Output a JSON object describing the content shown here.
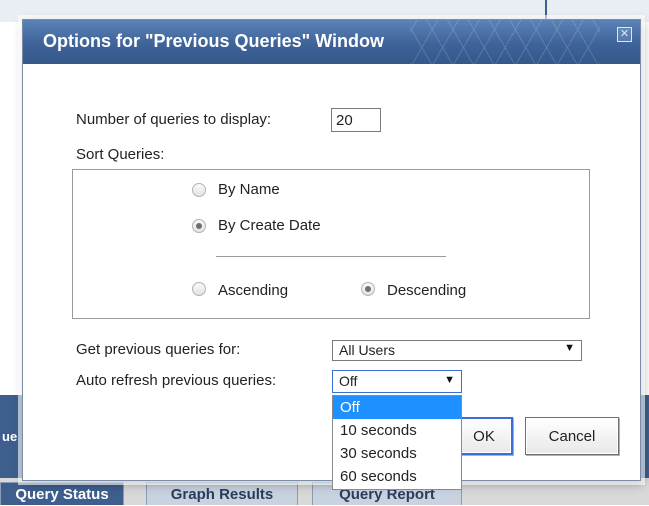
{
  "dialog": {
    "title": "Options for \"Previous Queries\" Window",
    "close_icon": "close-icon",
    "num_queries_label": "Number of queries to display:",
    "num_queries_value": "20",
    "sort_label": "Sort Queries:",
    "sort_by_options": [
      {
        "label": "By Name",
        "checked": false
      },
      {
        "label": "By Create Date",
        "checked": true
      }
    ],
    "sort_order_options": [
      {
        "label": "Ascending",
        "checked": false
      },
      {
        "label": "Descending",
        "checked": true
      }
    ],
    "get_for_label": "Get previous queries for:",
    "get_for_value": "All Users",
    "auto_refresh_label": "Auto refresh previous queries:",
    "auto_refresh_value": "Off",
    "auto_refresh_options": [
      "Off",
      "10 seconds",
      "30 seconds",
      "60 seconds"
    ],
    "ok_label": "OK",
    "cancel_label": "Cancel"
  },
  "background": {
    "left_tab_fragment": "ue",
    "tabs": [
      "Query Status",
      "Graph Results",
      "Query Report"
    ]
  },
  "colors": {
    "title_bar": "#3e6399",
    "selection": "#1e90ff",
    "focus": "#3a6fd8"
  }
}
